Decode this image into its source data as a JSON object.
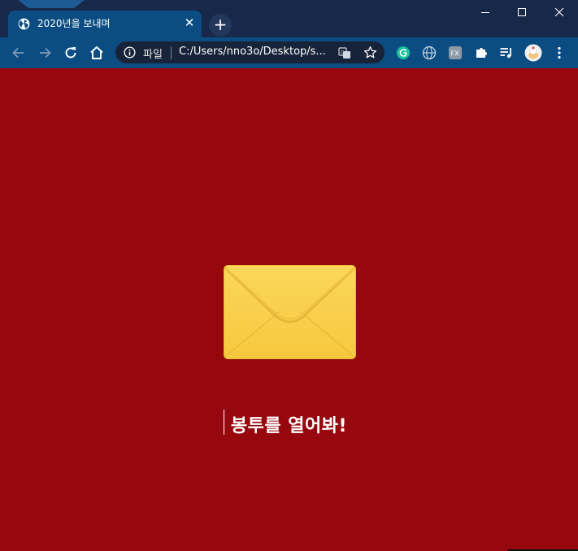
{
  "browser": {
    "tab": {
      "title": "2020년을 보내며",
      "close_glyph": "✕"
    },
    "new_tab_glyph": "+",
    "window_controls": {
      "minimize": "–",
      "maximize": "☐",
      "close": "✕"
    },
    "omnibox": {
      "scheme_label": "파일",
      "url": "C:/Users/nno3o/Desktop/s..."
    },
    "colors": {
      "frame": "#172848",
      "toolbar": "#0b4d82",
      "omnibox": "#172338"
    },
    "icons": [
      "back-arrow-icon",
      "forward-arrow-icon",
      "reload-icon",
      "home-icon",
      "info-icon",
      "translate-icon",
      "star-icon",
      "grammar-extension-icon",
      "globe-extension-icon",
      "fx-extension-icon",
      "puzzle-extension-icon",
      "media-queue-icon",
      "profile-avatar-icon",
      "menu-kebab-icon"
    ]
  },
  "page": {
    "background": "#97070e",
    "envelope_icon": "envelope-icon",
    "cta_text": "봉투를 열어봐!"
  }
}
